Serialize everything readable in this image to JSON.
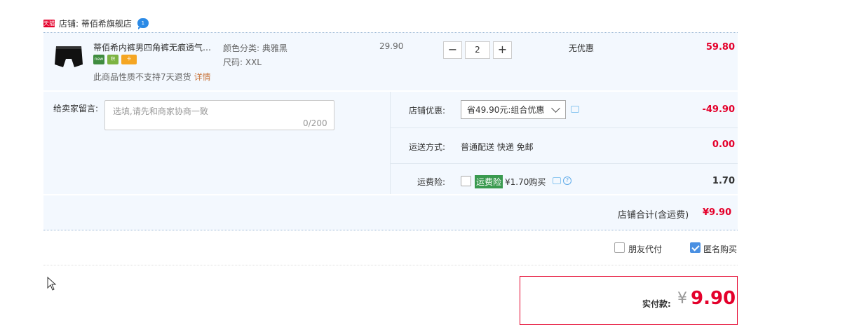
{
  "shop": {
    "badge": "天猫",
    "name": "店铺: 蒂佰希旗舰店",
    "chat_badge": "1"
  },
  "item": {
    "title": "蒂佰希内裤男四角裤无痕透气本...",
    "badges": [
      "new",
      "积",
      "卡"
    ],
    "no_return": "此商品性质不支持7天退货",
    "detail_link": "详情",
    "sku_color": "颜色分类: 典雅黑",
    "sku_size": "尺码: XXL",
    "unit_price": "29.90",
    "quantity": "2",
    "qty_minus": "−",
    "qty_plus": "+",
    "discount": "无优惠",
    "subtotal": "59.80"
  },
  "memo": {
    "label": "给卖家留言:",
    "placeholder": "选填,请先和商家协商一致",
    "count": "0/200"
  },
  "options": {
    "promo_label": "店铺优惠:",
    "promo_value": "省49.90元:组合优惠",
    "promo_amount": "-49.90",
    "shipping_label": "运送方式:",
    "shipping_value": "普通配送 快递 免邮",
    "shipping_amount": "0.00",
    "insurance_label": "运费险:",
    "insurance_tag": "运费险",
    "insurance_price": "¥1.70购买",
    "insurance_amount": "1.70",
    "help_glyph": "?"
  },
  "store_total": {
    "label": "店铺合计(含运费)",
    "value": "¥9.90"
  },
  "checkboxes": {
    "friend_pay": "朋友代付",
    "anonymous": "匿名购买"
  },
  "pay": {
    "label": "实付款:",
    "currency": "¥",
    "amount": "9.90"
  }
}
